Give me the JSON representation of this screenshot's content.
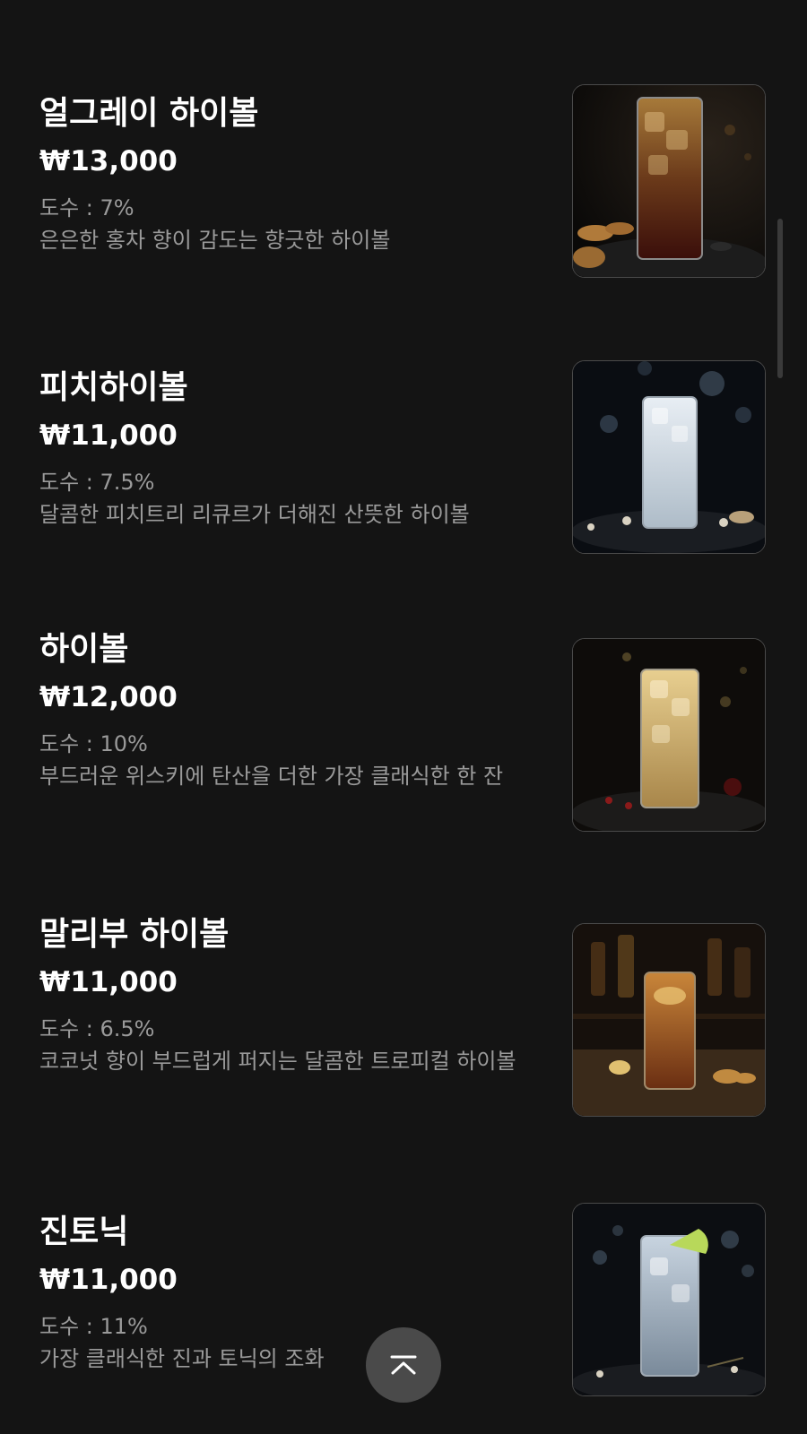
{
  "menu": {
    "items": [
      {
        "name": "얼그레이 하이볼",
        "price": "₩13,000",
        "abv": "도수 : 7%",
        "description": "은은한 홍차 향이 감도는 향긋한 하이볼",
        "image": "earl-grey-highball-photo"
      },
      {
        "name": "피치하이볼",
        "price": "₩11,000",
        "abv": "도수 : 7.5%",
        "description": "달콤한 피치트리 리큐르가 더해진 산뜻한 하이볼",
        "image": "peach-highball-photo"
      },
      {
        "name": "하이볼",
        "price": "₩12,000",
        "abv": "도수 : 10%",
        "description": "부드러운 위스키에 탄산을 더한 가장 클래식한 한 잔",
        "image": "classic-highball-photo"
      },
      {
        "name": "말리부 하이볼",
        "price": "₩11,000",
        "abv": "도수 : 6.5%",
        "description": "코코넛 향이 부드럽게 퍼지는 달콤한 트로피컬 하이볼",
        "image": "malibu-highball-photo"
      },
      {
        "name": "진토닉",
        "price": "₩11,000",
        "abv": "도수 : 11%",
        "description": "가장 클래식한 진과 토닉의 조화",
        "image": "gin-tonic-photo"
      }
    ]
  },
  "scroll_top_button": {
    "icon": "chevron-up-icon"
  },
  "colors": {
    "background": "#141414",
    "title_text": "#ffffff",
    "secondary_text": "#9a9a9a",
    "button_bg": "#4a4a4a"
  }
}
